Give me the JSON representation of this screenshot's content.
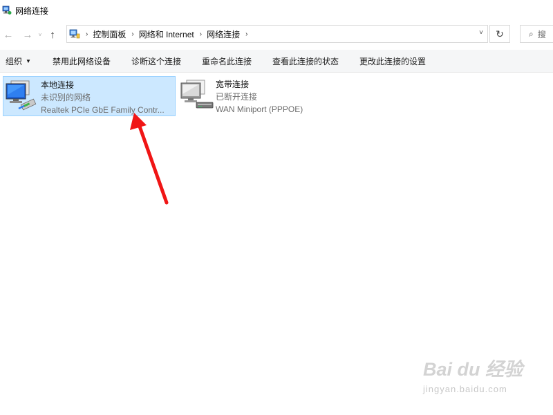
{
  "window": {
    "title": "网络连接",
    "icon": "network-connections-icon"
  },
  "navigation": {
    "back_icon": "←",
    "forward_icon": "→",
    "recent_icon": "˅",
    "up_icon": "↑",
    "breadcrumbs": [
      "控制面板",
      "网络和 Internet",
      "网络连接"
    ],
    "separator": "›",
    "dropdown_icon": "˅",
    "refresh_icon": "↻",
    "search_icon": "⌕",
    "search_placeholder": "搜"
  },
  "toolbar": {
    "organize": "组织",
    "organize_caret": "▼",
    "items": [
      "禁用此网络设备",
      "诊断这个连接",
      "重命名此连接",
      "查看此连接的状态",
      "更改此连接的设置"
    ]
  },
  "connections": [
    {
      "name": "本地连接",
      "status": "未识别的网络",
      "device": "Realtek PCIe GbE Family Contr...",
      "selected": true,
      "icon": "ethernet-adapter-icon"
    },
    {
      "name": "宽带连接",
      "status": "已断开连接",
      "device": "WAN Miniport (PPPOE)",
      "selected": false,
      "icon": "broadband-modem-icon"
    }
  ],
  "watermark": {
    "logo": "Bai du 经验",
    "url": "jingyan.baidu.com"
  },
  "colors": {
    "selection_bg": "#cce8ff",
    "selection_border": "#99d1ff",
    "toolbar_bg": "#f5f6f7",
    "annotation_arrow": "#f01515"
  }
}
